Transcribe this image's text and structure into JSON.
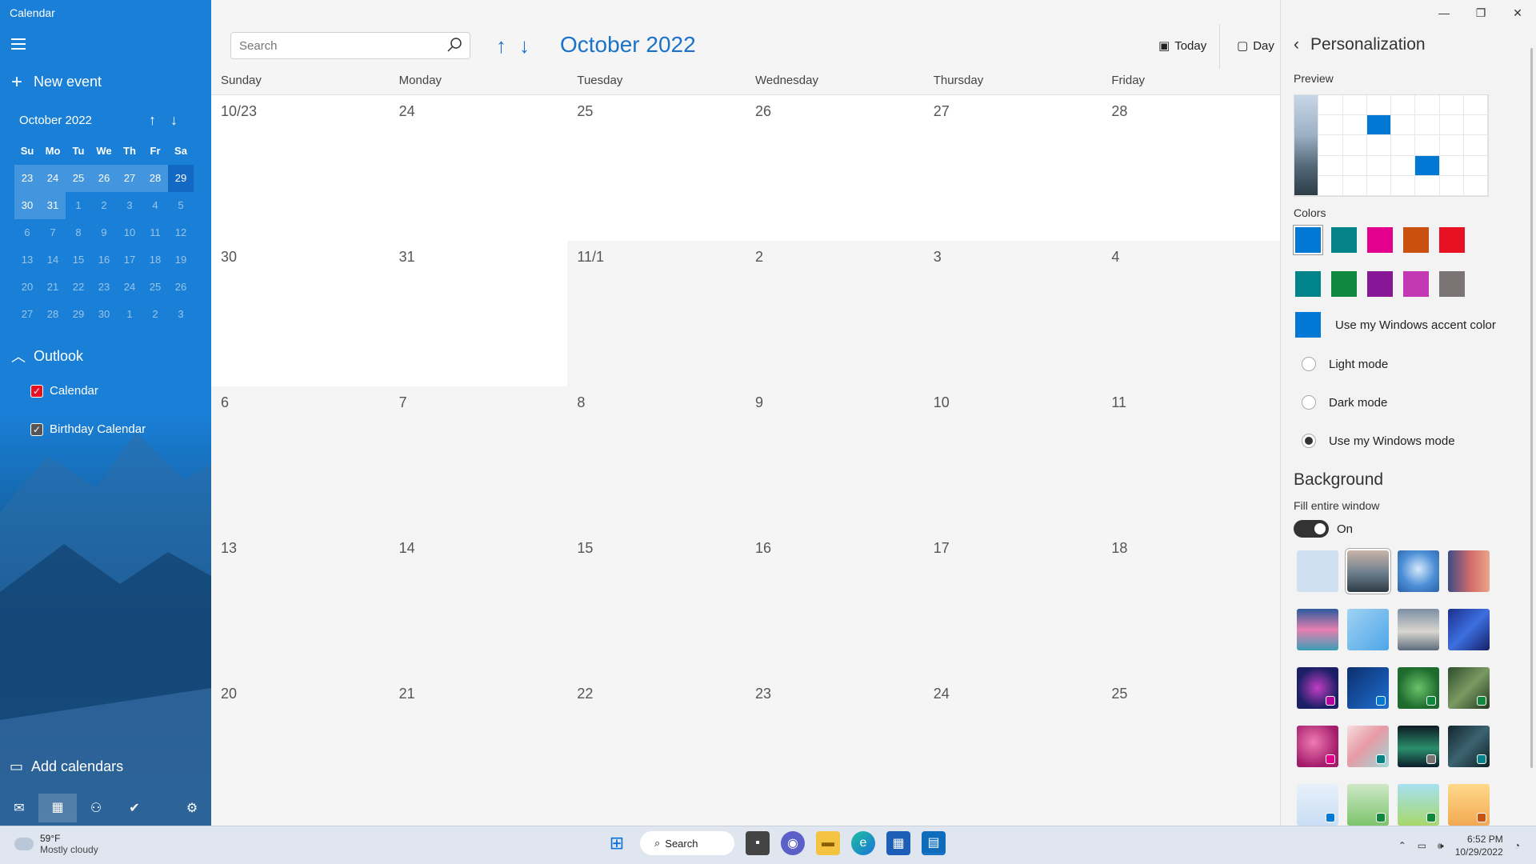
{
  "app": {
    "title": "Calendar"
  },
  "sidebar": {
    "new_event": "New event",
    "mini_month": "October 2022",
    "weekdays": [
      "Su",
      "Mo",
      "Tu",
      "We",
      "Th",
      "Fr",
      "Sa"
    ],
    "mini_weeks": [
      [
        "23",
        "24",
        "25",
        "26",
        "27",
        "28",
        "29"
      ],
      [
        "30",
        "31",
        "1",
        "2",
        "3",
        "4",
        "5"
      ],
      [
        "6",
        "7",
        "8",
        "9",
        "10",
        "11",
        "12"
      ],
      [
        "13",
        "14",
        "15",
        "16",
        "17",
        "18",
        "19"
      ],
      [
        "20",
        "21",
        "22",
        "23",
        "24",
        "25",
        "26"
      ],
      [
        "27",
        "28",
        "29",
        "30",
        "1",
        "2",
        "3"
      ]
    ],
    "account": "Outlook",
    "calendars": [
      "Calendar",
      "Birthday Calendar"
    ],
    "add_calendars": "Add calendars"
  },
  "main": {
    "search_placeholder": "Search",
    "month_title": "October 2022",
    "today": "Today",
    "day": "Day",
    "days_of_week": [
      "Sunday",
      "Monday",
      "Tuesday",
      "Wednesday",
      "Thursday",
      "Friday"
    ],
    "weeks": [
      [
        "10/23",
        "24",
        "25",
        "26",
        "27",
        "28"
      ],
      [
        "30",
        "31",
        "11/1",
        "2",
        "3",
        "4"
      ],
      [
        "6",
        "7",
        "8",
        "9",
        "10",
        "11"
      ],
      [
        "13",
        "14",
        "15",
        "16",
        "17",
        "18"
      ],
      [
        "20",
        "21",
        "22",
        "23",
        "24",
        "25"
      ]
    ]
  },
  "panel": {
    "title": "Personalization",
    "preview_label": "Preview",
    "colors_label": "Colors",
    "colors_row1": [
      "#0078d4",
      "#038387",
      "#e3008c",
      "#ca5010",
      "#e81123"
    ],
    "colors_row2": [
      "#00848c",
      "#10893e",
      "#881798",
      "#c239b3",
      "#7a7574"
    ],
    "accent_color": "#0078d4",
    "accent_label": "Use my Windows accent color",
    "light_mode": "Light mode",
    "dark_mode": "Dark mode",
    "windows_mode": "Use my Windows mode",
    "background_title": "Background",
    "fill_label": "Fill entire window",
    "toggle_state": "On"
  },
  "taskbar": {
    "temp": "59°F",
    "weather": "Mostly cloudy",
    "search": "Search",
    "time": "6:52 PM",
    "date": "10/29/2022"
  }
}
